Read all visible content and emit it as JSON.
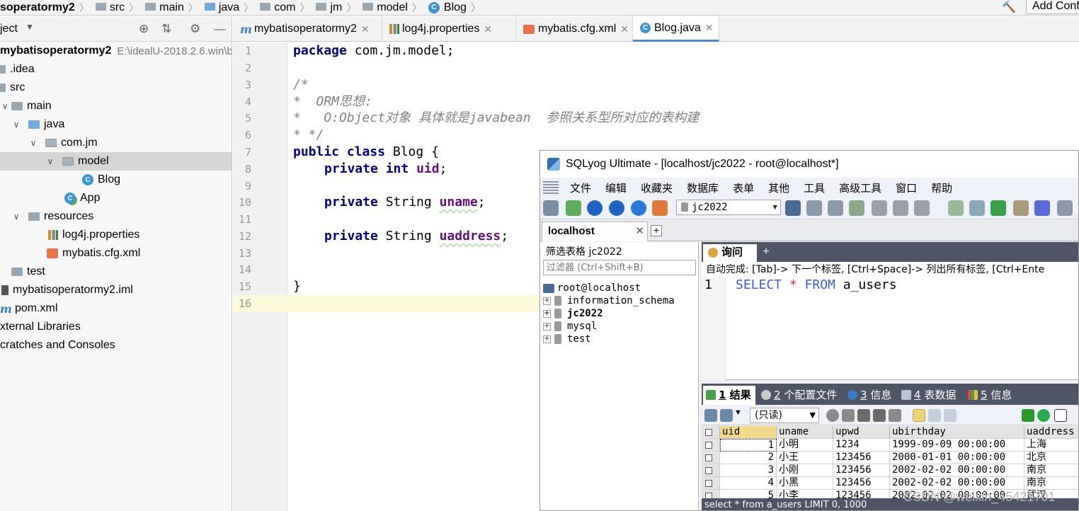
{
  "breadcrumbs": [
    "soperatormy2",
    "src",
    "main",
    "java",
    "com",
    "jm",
    "model",
    "Blog"
  ],
  "add_config_label": "Add Conf",
  "colors": {
    "accent": "#4a88c7",
    "keyword": "#000080",
    "field": "#660e7a",
    "sql_keyword": "#3c5bd6",
    "sqlyog_dark": "#4d5566"
  },
  "project": {
    "title": "ject",
    "tree": [
      {
        "label": "mybatisoperatormy2",
        "detail": "E:\\idealU-2018.2.6.win\\b"
      },
      {
        "label": ".idea"
      },
      {
        "label": "src"
      },
      {
        "label": "main"
      },
      {
        "label": "java"
      },
      {
        "label": "com.jm"
      },
      {
        "label": "model"
      },
      {
        "label": "Blog"
      },
      {
        "label": "App"
      },
      {
        "label": "resources"
      },
      {
        "label": "log4j.properties"
      },
      {
        "label": "mybatis.cfg.xml"
      },
      {
        "label": "test"
      },
      {
        "label": "mybatisoperatormy2.iml"
      },
      {
        "label": "pom.xml"
      },
      {
        "label": "xternal Libraries"
      },
      {
        "label": "cratches and Consoles"
      }
    ]
  },
  "editor": {
    "tabs": [
      {
        "label": "mybatisoperatormy2"
      },
      {
        "label": "log4j.properties"
      },
      {
        "label": "mybatis.cfg.xml"
      },
      {
        "label": "Blog.java"
      }
    ],
    "line_numbers": [
      "1",
      "2",
      "3",
      "4",
      "5",
      "6",
      "7",
      "8",
      "9",
      "10",
      "11",
      "12",
      "13",
      "14",
      "15",
      "16"
    ],
    "code": {
      "l1_kw": "package",
      "l1_rest": " com.jm.model;",
      "l3": "/*",
      "l4": "*  ORM思想:",
      "l5": "*   O:Object对象 具体就是javabean  参照关系型所对应的表构建",
      "l6": "* */",
      "l7_kw": "public class",
      "l7_rest": " Blog {",
      "l8_kw": "private int",
      "l8_field": "uid",
      "l8_end": ";",
      "l10_kw": "private",
      "l10_type": " String ",
      "l10_field": "uname",
      "l10_end": ";",
      "l12_kw": "private",
      "l12_type": " String ",
      "l12_field": "uaddress",
      "l12_end": ";",
      "l15": "}"
    }
  },
  "sqlyog": {
    "title": "SQLyog Ultimate - [localhost/jc2022 - root@localhost*]",
    "menu": [
      "文件",
      "编辑",
      "收藏夹",
      "数据库",
      "表单",
      "其他",
      "工具",
      "高级工具",
      "窗口",
      "帮助"
    ],
    "db_selector": "jc2022",
    "connection_tab": "localhost",
    "filter_label": "筛选表格 jc2022",
    "filter_placeholder": "过滤器 (Ctrl+Shift+B)",
    "server_node": "root@localhost",
    "databases": [
      "information_schema",
      "jc2022",
      "mysql",
      "test"
    ],
    "query_tab": "询问",
    "autocomplete_hint": "自动完成: [Tab]-> 下一个标签, [Ctrl+Space]-> 列出所有标签, [Ctrl+Ente",
    "sql_line_number": "1",
    "sql": {
      "kw1": "SELECT",
      "star": " * ",
      "kw2": "FROM",
      "table": " a_users"
    },
    "result_tabs": [
      {
        "num": "1",
        "label": " 结果"
      },
      {
        "num": "2",
        "label": " 个配置文件"
      },
      {
        "num": "3",
        "label": " 信息"
      },
      {
        "num": "4",
        "label": " 表数据"
      },
      {
        "num": "5",
        "label": " 信息"
      }
    ],
    "readonly_label": "(只读)",
    "grid": {
      "columns": [
        "uid",
        "uname",
        "upwd",
        "ubirthday",
        "uaddress"
      ],
      "rows": [
        [
          "1",
          "小明",
          "1234",
          "1999-09-09 00:00:00",
          "上海"
        ],
        [
          "2",
          "小王",
          "123456",
          "2000-01-01 00:00:00",
          "北京"
        ],
        [
          "3",
          "小刚",
          "123456",
          "2002-02-02 00:00:00",
          "南京"
        ],
        [
          "4",
          "小黑",
          "123456",
          "2002-02-02 00:00:00",
          "南京"
        ],
        [
          "5",
          "小李",
          "123456",
          "2002-02-02 00:00:00",
          "武汉"
        ]
      ]
    },
    "status_text": "select * from a_users LIMIT 0, 1000"
  },
  "watermark": "CSDN @weixin_45421701"
}
